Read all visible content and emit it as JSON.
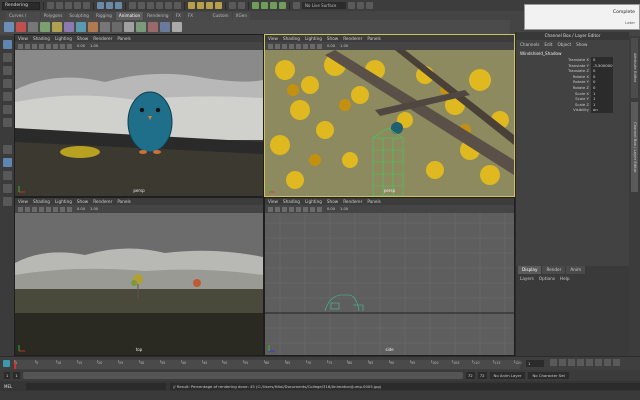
{
  "toolbar": {
    "mode": "Rendering",
    "live_surface": "No Live Surface"
  },
  "shelf_tabs": [
    {
      "label": "Curves / Surfaces",
      "active": false
    },
    {
      "label": "Polygons",
      "active": false
    },
    {
      "label": "Sculpting",
      "active": false
    },
    {
      "label": "Rigging",
      "active": false
    },
    {
      "label": "Animation",
      "active": true
    },
    {
      "label": "Rendering",
      "active": false
    },
    {
      "label": "FX",
      "active": false
    },
    {
      "label": "FX Caching",
      "active": false
    },
    {
      "label": "Custom",
      "active": false
    },
    {
      "label": "XGen",
      "active": false
    }
  ],
  "viewport_menus": [
    "View",
    "Shading",
    "Lighting",
    "Show",
    "Renderer",
    "Panels"
  ],
  "viewports": {
    "top_left": {
      "camera": "persp",
      "near": "0.00",
      "far": "1.00"
    },
    "top_right": {
      "camera": "persp",
      "near": "0.00",
      "far": "1.00"
    },
    "bottom_left": {
      "camera": "top",
      "near": "0.00",
      "far": "1.00"
    },
    "bottom_right": {
      "camera": "side",
      "near": "0.00",
      "far": "1.00"
    }
  },
  "notification": {
    "title": "Complete",
    "subtitle": "Later"
  },
  "channel_box": {
    "title": "Channel Box / Layer Editor",
    "menus": [
      "Channels",
      "Edit",
      "Object",
      "Show"
    ],
    "object": "Windshield_Shadow",
    "attributes": [
      {
        "name": "Translate X",
        "value": "0"
      },
      {
        "name": "Translate Y",
        "value": "-3.500000"
      },
      {
        "name": "Translate Z",
        "value": "0"
      },
      {
        "name": "Rotate X",
        "value": "0"
      },
      {
        "name": "Rotate Y",
        "value": "0"
      },
      {
        "name": "Rotate Z",
        "value": "0"
      },
      {
        "name": "Scale X",
        "value": "1"
      },
      {
        "name": "Scale Y",
        "value": "1"
      },
      {
        "name": "Scale Z",
        "value": "1"
      },
      {
        "name": "Visibility",
        "value": "on"
      }
    ]
  },
  "side_tabs": [
    "Attribute Editor",
    "Channel Box / Layer Editor"
  ],
  "layer_editor": {
    "tabs": [
      {
        "label": "Display",
        "active": true
      },
      {
        "label": "Render",
        "active": false
      },
      {
        "label": "Anim",
        "active": false
      }
    ],
    "menus": [
      "Layers",
      "Options",
      "Help"
    ]
  },
  "timeline": {
    "labels": [
      "1",
      "5",
      "10",
      "15",
      "20",
      "25",
      "30",
      "35",
      "40",
      "45",
      "50",
      "55",
      "60",
      "65",
      "70",
      "75",
      "80",
      "85",
      "90",
      "95",
      "100",
      "105",
      "110",
      "115",
      "120"
    ],
    "current_frame": "1",
    "current_fraction": 0.0
  },
  "range": {
    "start": "1",
    "inner_start": "1",
    "inner_end": "72",
    "end": "72",
    "anim_layer": "No Anim Layer",
    "char_set": "No Character Set"
  },
  "command_line": {
    "lang": "MEL",
    "result": "// Result: Percentage of rendering done: 45 (C:/Users/Hitol/Documents/College/316/Animation/Jump.0005.jpg)"
  }
}
